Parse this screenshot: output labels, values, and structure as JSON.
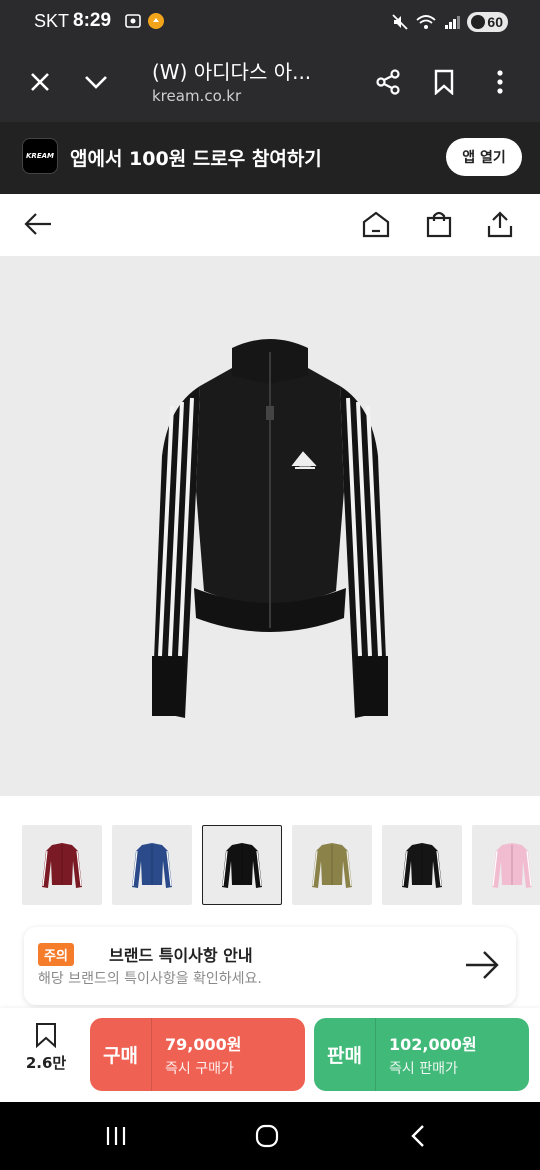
{
  "status": {
    "carrier": "SKT",
    "time": "8:29",
    "battery": "60"
  },
  "browser": {
    "title": "(W) 아디다스 아...",
    "url": "kream.co.kr",
    "icons": [
      "close-icon",
      "chevron-down-icon",
      "share-icon",
      "bookmark-icon",
      "more-vert-icon"
    ]
  },
  "banner": {
    "logo": "KREAM",
    "text": "앱에서 100원 드로우 참여하기",
    "open_label": "앱 열기"
  },
  "header": {
    "icons": [
      "back-arrow-icon",
      "home-icon",
      "shopping-bag-icon",
      "share-icon"
    ]
  },
  "thumbnails": [
    {
      "color": "#7a1a24",
      "stripe": "#ffffff"
    },
    {
      "color": "#2a4a8a",
      "stripe": "#ffffff"
    },
    {
      "color": "#111111",
      "stripe": "#ffffff",
      "selected": true
    },
    {
      "color": "#8a8248",
      "stripe": "#f0f0f0"
    },
    {
      "color": "#151515",
      "stripe": "#ffffff"
    },
    {
      "color": "#f2bcd0",
      "stripe": "#ffffff"
    }
  ],
  "notice": {
    "tag": "주의",
    "heading": "브랜드 특이사항 안내",
    "subtext": "해당 브랜드의 특이사항을 확인하세요."
  },
  "actions": {
    "wish_count": "2.6만",
    "buy": {
      "label": "구매",
      "price": "79,000원",
      "desc": "즉시 구매가"
    },
    "sell": {
      "label": "판매",
      "price": "102,000원",
      "desc": "즉시 판매가"
    }
  },
  "colors": {
    "buy": "#ef6253",
    "sell": "#41b979",
    "notice_tag": "#f57c2b"
  }
}
